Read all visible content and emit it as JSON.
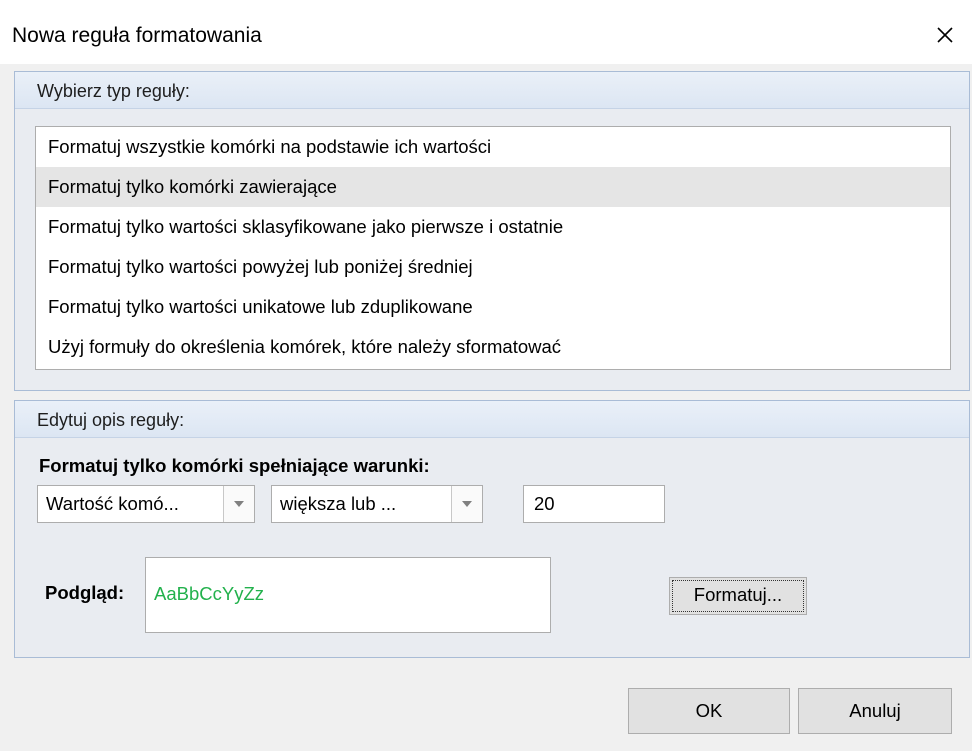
{
  "window": {
    "title": "Nowa reguła formatowania"
  },
  "rule_type": {
    "header": "Wybierz typ reguły:",
    "items": [
      {
        "label": "Formatuj wszystkie komórki na podstawie ich wartości",
        "selected": false
      },
      {
        "label": "Formatuj tylko komórki zawierające",
        "selected": true
      },
      {
        "label": "Formatuj tylko wartości sklasyfikowane jako pierwsze i ostatnie",
        "selected": false
      },
      {
        "label": "Formatuj tylko wartości powyżej lub poniżej średniej",
        "selected": false
      },
      {
        "label": "Formatuj tylko wartości unikatowe lub zduplikowane",
        "selected": false
      },
      {
        "label": "Użyj formuły do określenia komórek, które należy sformatować",
        "selected": false
      }
    ]
  },
  "rule_description": {
    "header": "Edytuj opis reguły:",
    "condition_label": "Formatuj tylko komórki spełniające warunki:",
    "field_combo": "Wartość komó...",
    "operator_combo": "większa lub ...",
    "value": "20",
    "preview_label": "Podgląd:",
    "preview_text": "AaBbCcYyZz",
    "preview_color": "#22b14c",
    "format_button": "Formatuj..."
  },
  "buttons": {
    "ok": "OK",
    "cancel": "Anuluj"
  },
  "icons": {
    "close": "close-icon",
    "dropdown": "chevron-down-icon"
  }
}
